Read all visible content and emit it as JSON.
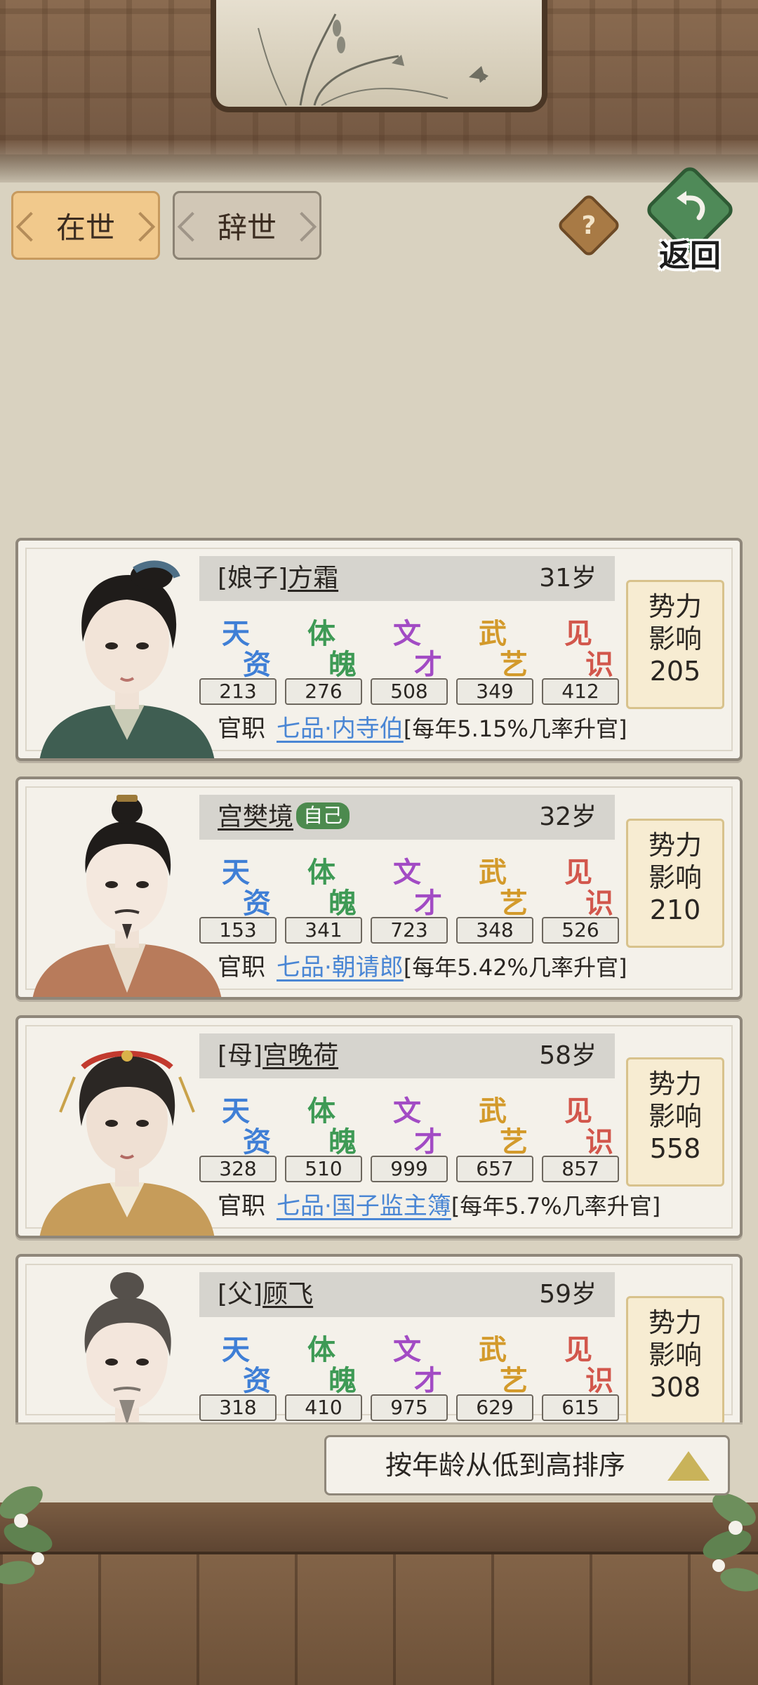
{
  "tabs": [
    {
      "label": "在世",
      "active": true
    },
    {
      "label": "辞世",
      "active": false
    }
  ],
  "header": {
    "help_label": "?",
    "back_label": "返回"
  },
  "attributes": [
    "天资",
    "体魄",
    "文才",
    "武艺",
    "见识"
  ],
  "attribute_colors": [
    "#3f7fd6",
    "#3e9a55",
    "#a24bc4",
    "#d39a2b",
    "#d2574c"
  ],
  "post_label": "官职",
  "influence_label": [
    "势力",
    "影响"
  ],
  "characters": [
    {
      "relation": "[娘子]",
      "name": "方霜",
      "self_badge": "",
      "age": "31岁",
      "stats": [
        "213",
        "276",
        "508",
        "349",
        "412"
      ],
      "post_rank": "七品·内寺伯",
      "post_chance": "[每年5.15%几率升官]",
      "influence": "205"
    },
    {
      "relation": "",
      "name": "宫樊境",
      "self_badge": "自己",
      "age": "32岁",
      "stats": [
        "153",
        "341",
        "723",
        "348",
        "526"
      ],
      "post_rank": "七品·朝请郎",
      "post_chance": "[每年5.42%几率升官]",
      "influence": "210"
    },
    {
      "relation": "[母]",
      "name": "宫晚荷",
      "self_badge": "",
      "age": "58岁",
      "stats": [
        "328",
        "510",
        "999",
        "657",
        "857"
      ],
      "post_rank": "七品·国子监主簿",
      "post_chance": "[每年5.7%几率升官]",
      "influence": "558"
    },
    {
      "relation": "[父]",
      "name": "顾飞",
      "self_badge": "",
      "age": "59岁",
      "stats": [
        "318",
        "410",
        "975",
        "629",
        "615"
      ],
      "post_rank": "",
      "post_chance": "",
      "influence": "308"
    }
  ],
  "sort": {
    "label": "按年龄从低到高排序"
  }
}
